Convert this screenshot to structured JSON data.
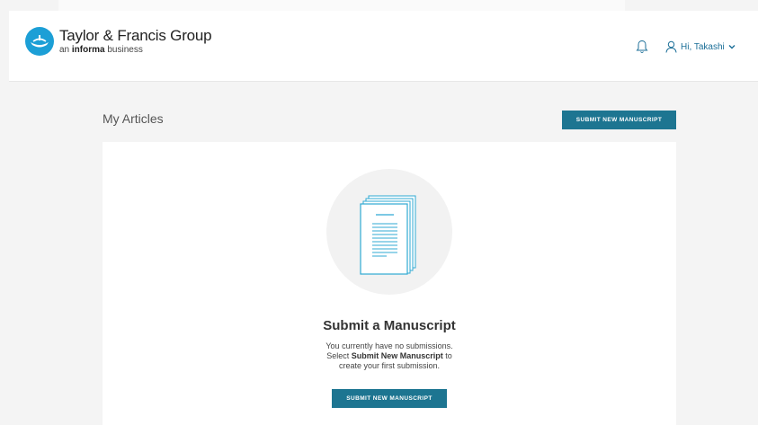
{
  "header": {
    "brand_name": "Taylor & Francis Group",
    "brand_sub_prefix": "an",
    "brand_sub_bold": "informa",
    "brand_sub_suffix": "business",
    "greeting": "Hi, Takashi",
    "icons": {
      "notifications": "bell-icon",
      "user": "user-icon",
      "dropdown": "chevron-down-icon"
    }
  },
  "main": {
    "title": "My Articles",
    "submit_button_label": "SUBMIT NEW MANUSCRIPT"
  },
  "empty_state": {
    "heading": "Submit a Manuscript",
    "line1": "You currently have no submissions.",
    "line2_prefix": "Select",
    "line2_bold": "Submit New Manuscript",
    "line2_suffix": "to",
    "line3": "create your first submission.",
    "button_label": "SUBMIT NEW MANUSCRIPT",
    "illustration": "document-stack-icon"
  },
  "colors": {
    "brand_blue": "#1c9fd6",
    "button_teal": "#1d7591",
    "link_blue": "#1c6f98",
    "page_bg": "#f4f4f4"
  }
}
